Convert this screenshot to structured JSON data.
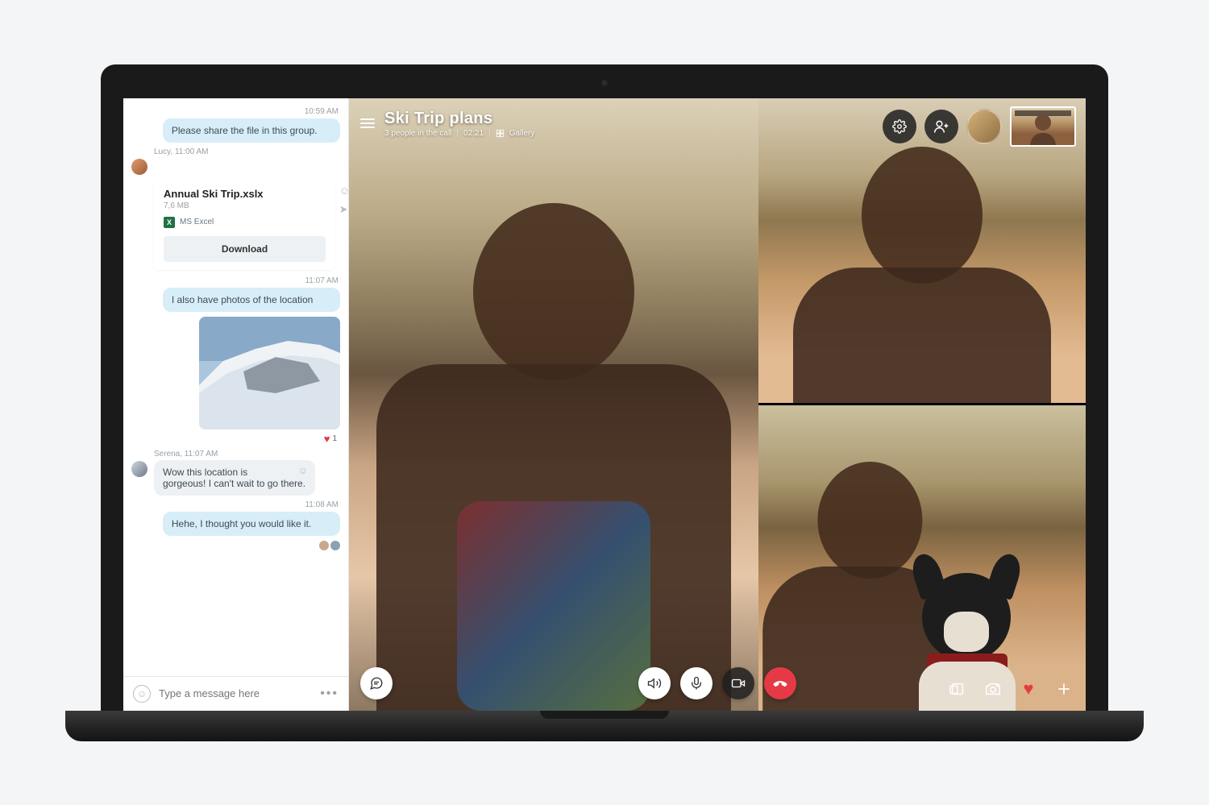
{
  "chat": {
    "ts1": "10:59 AM",
    "msg1": "Please share the file in this group.",
    "sender1_line": "Lucy, 11:00 AM",
    "file": {
      "name": "Annual Ski Trip.xslx",
      "size": "7,6 MB",
      "type_label": "MS Excel",
      "type_icon": "X",
      "download": "Download"
    },
    "ts2": "11:07 AM",
    "msg2": "I also have photos of the location",
    "reaction_count": "1",
    "sender2_line": "Serena, 11:07 AM",
    "msg3": "Wow this location is gorgeous! I can't wait to go there.",
    "ts3": "11:08 AM",
    "msg4": "Hehe, I thought you would like it.",
    "placeholder": "Type a message here"
  },
  "call": {
    "title": "Ski Trip plans",
    "participants": "3 people in the call",
    "duration": "02:21",
    "gallery": "Gallery"
  }
}
